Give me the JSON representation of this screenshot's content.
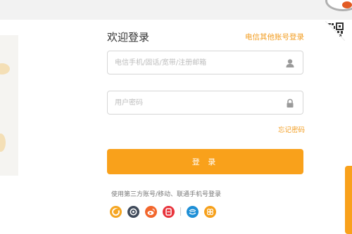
{
  "login": {
    "title": "欢迎登录",
    "other_account_link": "电信其他账号登录",
    "account_placeholder": "电信手机/固话/宽带/注册邮箱",
    "password_placeholder": "用户密码",
    "forgot_password": "忘记密码",
    "submit_label": "登 录",
    "third_party_text": "使用第三方账号/移动、联通手机号登录"
  },
  "colors": {
    "accent": "#f9a11b",
    "link": "#f29c1f",
    "border": "#d6d6d6"
  },
  "third_party_icons": [
    "alipay-icon",
    "netease-icon",
    "weibo-icon",
    "social-icon",
    "china-mobile-icon",
    "china-unicom-icon"
  ]
}
